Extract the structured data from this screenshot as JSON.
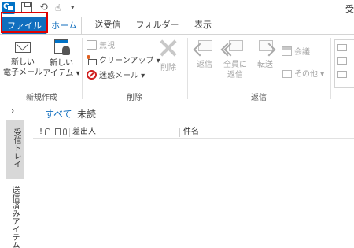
{
  "titlebar": {
    "window_title": "受",
    "app_icon_letter": "O",
    "qat_more_glyph": "▾"
  },
  "tabs": [
    {
      "label": "ファイル"
    },
    {
      "label": "ホーム"
    },
    {
      "label": "送受信"
    },
    {
      "label": "フォルダー"
    },
    {
      "label": "表示"
    }
  ],
  "ribbon": {
    "new": {
      "group_label": "新規作成",
      "new_mail": [
        "新しい",
        "電子メール"
      ],
      "new_items": [
        "新しい",
        "アイテム ▾"
      ]
    },
    "delete": {
      "group_label": "削除",
      "ignore": "無視",
      "cleanup": "クリーンアップ ▾",
      "junk": "迷惑メール ▾",
      "delete": "削除"
    },
    "respond": {
      "group_label": "返信",
      "reply": "返信",
      "reply_all": [
        "全員に",
        "返信"
      ],
      "forward": "転送",
      "meeting": "会議",
      "more": "その他 ▾"
    }
  },
  "folder_pane": {
    "expand_glyph": "›",
    "inbox": "受信トレイ",
    "sent": "送信済みアイテム"
  },
  "message_list": {
    "filters": {
      "all": "すべて",
      "unread": "未読"
    },
    "columns": {
      "importance": "!",
      "from": "差出人",
      "subject": "件名"
    }
  },
  "colors": {
    "file_tab_bg": "#106ebe",
    "accent_text": "#106ebe",
    "highlight_box": "#e00000",
    "inbox_bg": "#d8d8d8"
  },
  "icons": {
    "app": "outlook-icon",
    "save": "save-icon",
    "undo": "undo-icon",
    "touch": "touch-mode-icon",
    "new_mail": "new-mail-icon",
    "new_items": "new-items-icon",
    "ignore": "ignore-icon",
    "cleanup": "cleanup-icon",
    "junk": "junk-icon",
    "delete": "delete-icon",
    "reply": "reply-icon",
    "reply_all": "reply-all-icon",
    "forward": "forward-icon",
    "meeting": "meeting-icon",
    "more": "more-icon"
  }
}
